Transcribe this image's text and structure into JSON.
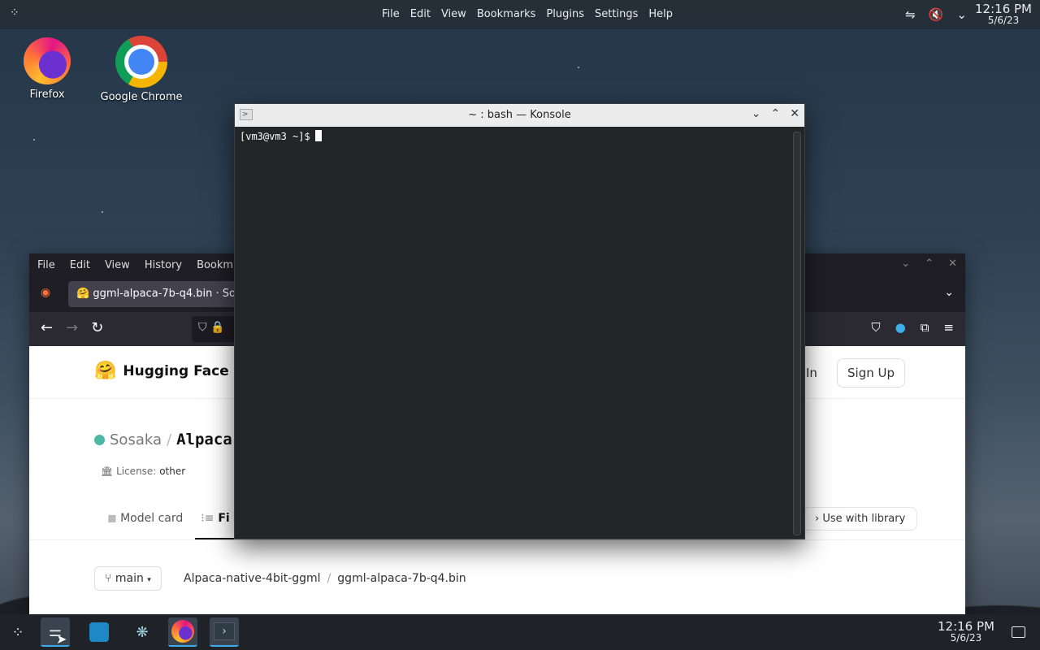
{
  "top_panel": {
    "menu": [
      "File",
      "Edit",
      "View",
      "Bookmarks",
      "Plugins",
      "Settings",
      "Help"
    ],
    "clock": {
      "time": "12:16 PM",
      "date": "5/6/23"
    }
  },
  "desktop_icons": [
    {
      "label": "Firefox"
    },
    {
      "label": "Google Chrome"
    }
  ],
  "konsole": {
    "title": "~ : bash — Konsole",
    "prompt": "[vm3@vm3 ~]$"
  },
  "firefox": {
    "menu": [
      "File",
      "Edit",
      "View",
      "History",
      "Bookm"
    ],
    "tab_title": "ggml-alpaca-7b-q4.bin · So",
    "page": {
      "brand": "Hugging Face",
      "sign_in": "In",
      "sign_up": "Sign Up",
      "repo_owner": "Sosaka",
      "repo_slash": "/",
      "repo_name": "Alpaca-",
      "license_label": "License:",
      "license_value": "other",
      "tab_model_card": "Model card",
      "tab_files": "Fi",
      "use_with_library": "Use with library",
      "branch": "main",
      "crumb_repo": "Alpaca-native-4bit-ggml",
      "crumb_sep": "/",
      "crumb_file": "ggml-alpaca-7b-q4.bin"
    }
  },
  "taskbar": {
    "clock": {
      "time": "12:16 PM",
      "date": "5/6/23"
    }
  }
}
